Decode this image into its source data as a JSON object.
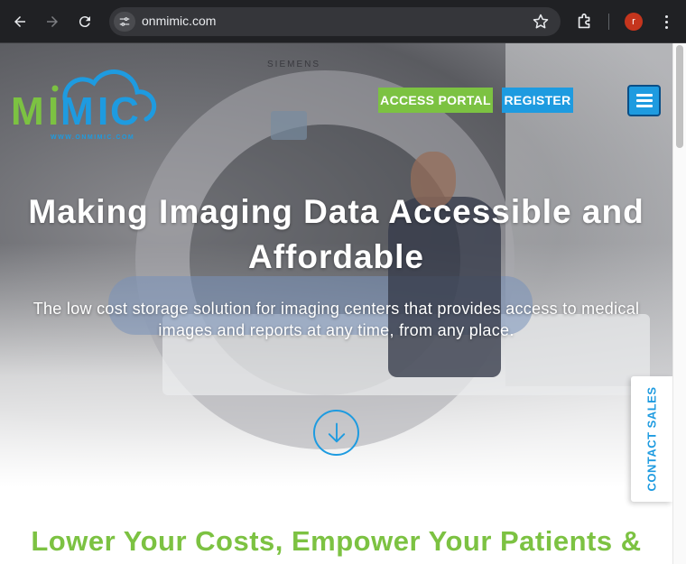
{
  "browser": {
    "url": "onmimic.com",
    "profile_initial": "r",
    "back_icon": "back-arrow-icon",
    "forward_icon": "forward-arrow-icon",
    "reload_icon": "reload-icon",
    "site_info_icon": "tune-icon",
    "bookmark_icon": "star-icon",
    "extensions_icon": "puzzle-icon",
    "menu_icon": "kebab-icon"
  },
  "site": {
    "logo_text": "MIMIC",
    "logo_tagline": "WWW.ONMIMIC.COM",
    "nav": {
      "access_portal": "ACCESS PORTAL",
      "register": "REGISTER",
      "menu_icon": "hamburger-icon"
    },
    "hero": {
      "title": "Making Imaging Data Accessible and Affordable",
      "subtitle": "The low cost storage solution for imaging centers that provides access to medical images and reports at any time, from any place.",
      "scroll_icon": "down-arrow-circle-icon"
    },
    "contact_tab": "CONTACT SALES",
    "section_heading": "Lower Your Costs, Empower Your Patients &"
  },
  "colors": {
    "brand_green": "#7cc242",
    "brand_blue": "#1e9be0",
    "chrome_bg": "#202124"
  }
}
